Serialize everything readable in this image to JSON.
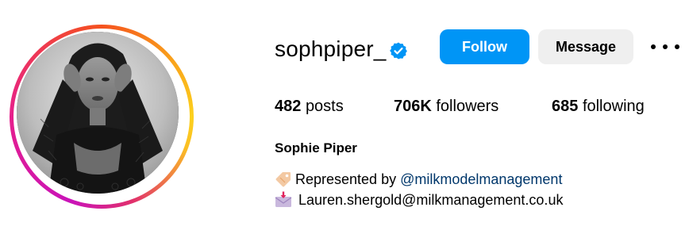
{
  "profile": {
    "username": "sophpiper_",
    "verified": true,
    "follow_label": "Follow",
    "message_label": "Message",
    "stats": {
      "posts_count": "482",
      "posts_label": "posts",
      "followers_count": "706K",
      "followers_label": "followers",
      "following_count": "685",
      "following_label": "following"
    },
    "full_name": "Sophie Piper",
    "bio": {
      "line1_prefix": "Represented by ",
      "line1_mention": "@milkmodelmanagement",
      "line1_icon": "label-tag-icon",
      "line2_text": "Lauren.shergold@milkmanagement.co.uk",
      "line2_icon": "incoming-envelope-icon"
    }
  },
  "colors": {
    "follow_button": "#0095f6",
    "message_button": "#efefef",
    "verified_badge": "#0095f6",
    "mention": "#00376b"
  }
}
